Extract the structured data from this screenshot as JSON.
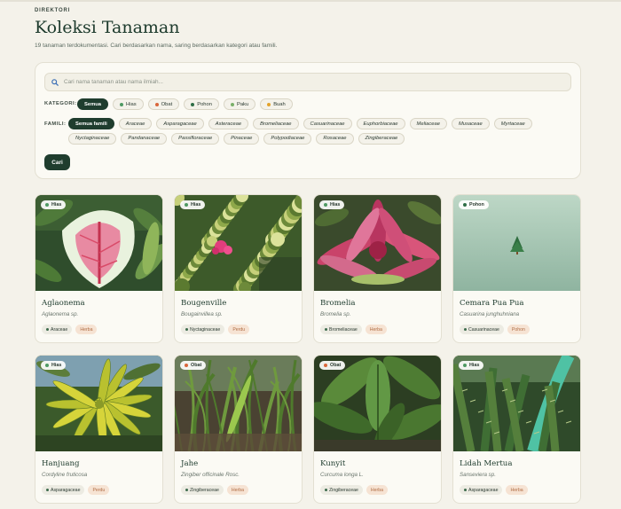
{
  "header": {
    "eyebrow": "DIREKTORI",
    "title": "Koleksi Tanaman",
    "subtitle": "19 tanaman terdokumentasi. Cari berdasarkan nama, saring berdasarkan kategori atau famili."
  },
  "search": {
    "placeholder": "Cari nama tanaman atau nama ilmiah...",
    "value": ""
  },
  "filters": {
    "kategori_label": "KATEGORI:",
    "kategori": [
      {
        "label": "Semua",
        "active": true,
        "color": ""
      },
      {
        "label": "Hias",
        "active": false,
        "color": "#4e9a63"
      },
      {
        "label": "Obat",
        "active": false,
        "color": "#d9663b"
      },
      {
        "label": "Pohon",
        "active": false,
        "color": "#2f6e47"
      },
      {
        "label": "Paku",
        "active": false,
        "color": "#7ab06a"
      },
      {
        "label": "Buah",
        "active": false,
        "color": "#e3a32c"
      }
    ],
    "famili_label": "FAMILI:",
    "famili": [
      {
        "label": "Semua famili",
        "active": true
      },
      {
        "label": "Araceae",
        "active": false
      },
      {
        "label": "Asparagaceae",
        "active": false
      },
      {
        "label": "Asteraceae",
        "active": false
      },
      {
        "label": "Bromeliaceae",
        "active": false
      },
      {
        "label": "Casuarinaceae",
        "active": false
      },
      {
        "label": "Euphorbiaceae",
        "active": false
      },
      {
        "label": "Meliaceae",
        "active": false
      },
      {
        "label": "Musaceae",
        "active": false
      },
      {
        "label": "Myrtaceae",
        "active": false
      },
      {
        "label": "Nyctaginaceae",
        "active": false
      },
      {
        "label": "Pandanaceae",
        "active": false
      },
      {
        "label": "Passifloraceae",
        "active": false
      },
      {
        "label": "Pinaceae",
        "active": false
      },
      {
        "label": "Polypodiaceae",
        "active": false
      },
      {
        "label": "Rosaceae",
        "active": false
      },
      {
        "label": "Zingiberaceae",
        "active": false
      }
    ],
    "submit_label": "Cari"
  },
  "plants": [
    {
      "name": "Aglaonema",
      "scientific": "Aglaonema sp.",
      "category": "Hias",
      "category_color": "#4e9a63",
      "family": "Araceae",
      "habit": "Herba",
      "photo": "aglaonema"
    },
    {
      "name": "Bougenville",
      "scientific": "Bougainvillea sp.",
      "category": "Hias",
      "category_color": "#4e9a63",
      "family": "Nyctaginaceae",
      "habit": "Perdu",
      "photo": "bougenville"
    },
    {
      "name": "Bromelia",
      "scientific": "Bromelia sp.",
      "category": "Hias",
      "category_color": "#4e9a63",
      "family": "Bromeliaceae",
      "habit": "Herba",
      "photo": "bromelia"
    },
    {
      "name": "Cemara Pua Pua",
      "scientific": "Casuarina junghuhniana",
      "category": "Pohon",
      "category_color": "#2f6e47",
      "family": "Casuarinaceae",
      "habit": "Pohon",
      "photo": "cemara"
    },
    {
      "name": "Hanjuang",
      "scientific": "Cordyline fruticosa",
      "category": "Hias",
      "category_color": "#4e9a63",
      "family": "Asparagaceae",
      "habit": "Perdu",
      "photo": "hanjuang"
    },
    {
      "name": "Jahe",
      "scientific": "Zingiber officinale Rosc.",
      "category": "Obat",
      "category_color": "#d9663b",
      "family": "Zingiberaceae",
      "habit": "Herba",
      "photo": "jahe"
    },
    {
      "name": "Kunyit",
      "scientific": "Curcuma longa L.",
      "category": "Obat",
      "category_color": "#d9663b",
      "family": "Zingiberaceae",
      "habit": "Herba",
      "photo": "kunyit"
    },
    {
      "name": "Lidah Mertua",
      "scientific": "Sanseviera sp.",
      "category": "Hias",
      "category_color": "#4e9a63",
      "family": "Asparagaceae",
      "habit": "Herba",
      "photo": "lidah"
    }
  ]
}
